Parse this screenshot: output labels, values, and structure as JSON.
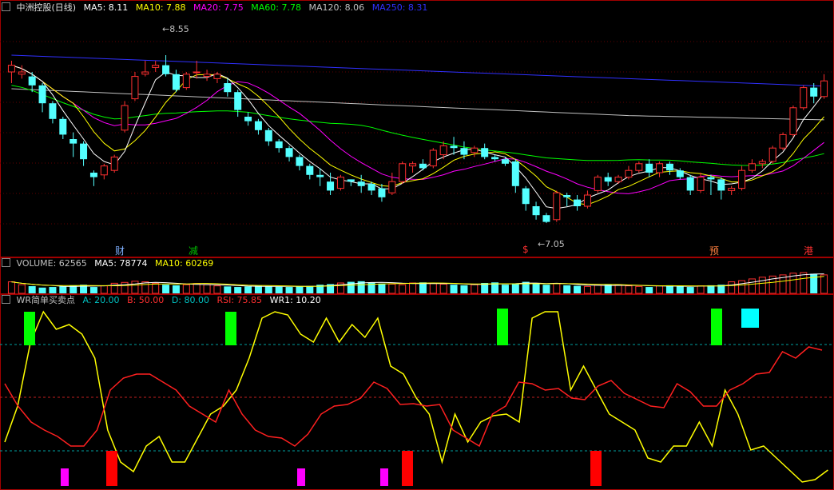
{
  "main": {
    "title": "中洲控股(日线)",
    "ma": [
      {
        "label": "MA5: 8.11",
        "color": "#ffffff"
      },
      {
        "label": "MA10: 7.88",
        "color": "#ffff00"
      },
      {
        "label": "MA20: 7.75",
        "color": "#ff00ff"
      },
      {
        "label": "MA60: 7.78",
        "color": "#00ff00"
      },
      {
        "label": "MA120: 8.06",
        "color": "#c0c0c0"
      },
      {
        "label": "MA250: 8.31",
        "color": "#3030ff"
      }
    ],
    "high_label": "8.55",
    "low_label": "7.05",
    "events": [
      {
        "text": "财",
        "color": "#7fb0ff",
        "pos": 0.14
      },
      {
        "text": "减",
        "color": "#00c000",
        "pos": 0.23
      },
      {
        "text": "$",
        "color": "#ff3030",
        "pos": 0.63
      },
      {
        "text": "预",
        "color": "#ff8040",
        "pos": 0.855
      },
      {
        "text": "港",
        "color": "#ff3030",
        "pos": 0.97
      }
    ]
  },
  "volume": {
    "labels": [
      {
        "label": "VOLUME: 62565",
        "color": "#c0c0c0"
      },
      {
        "label": "MA5: 78774",
        "color": "#ffffff"
      },
      {
        "label": "MA10: 60269",
        "color": "#ffff00"
      }
    ]
  },
  "wr": {
    "labels": [
      {
        "label": "WR简单买卖点",
        "color": "#c0c0c0"
      },
      {
        "label": "A: 20.00",
        "color": "#00c0c0"
      },
      {
        "label": "B: 50.00",
        "color": "#ff3030"
      },
      {
        "label": "D: 80.00",
        "color": "#00c0c0"
      },
      {
        "label": "RSI: 75.85",
        "color": "#ff3030"
      },
      {
        "label": "WR1: 10.20",
        "color": "#ffffff"
      }
    ]
  },
  "chart_data": {
    "type": "candlestick",
    "price_range": [
      6.9,
      8.9
    ],
    "candles": [
      [
        8.4,
        8.46,
        8.3,
        8.5
      ],
      [
        8.38,
        8.4,
        8.34,
        8.46
      ],
      [
        8.36,
        8.28,
        8.22,
        8.4
      ],
      [
        8.28,
        8.12,
        8.04,
        8.3
      ],
      [
        8.12,
        7.98,
        7.94,
        8.14
      ],
      [
        7.98,
        7.84,
        7.8,
        8.0
      ],
      [
        7.8,
        7.76,
        7.64,
        7.86
      ],
      [
        7.76,
        7.62,
        7.56,
        7.78
      ],
      [
        7.5,
        7.46,
        7.38,
        7.52
      ],
      [
        7.48,
        7.56,
        7.44,
        7.58
      ],
      [
        7.52,
        7.64,
        7.5,
        7.66
      ],
      [
        7.88,
        8.1,
        7.86,
        8.14
      ],
      [
        8.16,
        8.36,
        8.14,
        8.4
      ],
      [
        8.38,
        8.4,
        8.36,
        8.5
      ],
      [
        8.44,
        8.46,
        8.4,
        8.5
      ],
      [
        8.46,
        8.38,
        8.36,
        8.55
      ],
      [
        8.38,
        8.24,
        8.22,
        8.42
      ],
      [
        8.26,
        8.38,
        8.24,
        8.4
      ],
      [
        8.4,
        8.4,
        8.34,
        8.5
      ],
      [
        8.36,
        8.38,
        8.32,
        8.42
      ],
      [
        8.34,
        8.38,
        8.3,
        8.4
      ],
      [
        8.3,
        8.22,
        8.18,
        8.34
      ],
      [
        8.22,
        8.06,
        8.0,
        8.24
      ],
      [
        8.0,
        7.96,
        7.92,
        8.04
      ],
      [
        7.96,
        7.88,
        7.84,
        7.98
      ],
      [
        7.88,
        7.78,
        7.74,
        7.9
      ],
      [
        7.78,
        7.72,
        7.68,
        7.8
      ],
      [
        7.72,
        7.64,
        7.6,
        7.74
      ],
      [
        7.64,
        7.56,
        7.52,
        7.66
      ],
      [
        7.56,
        7.48,
        7.44,
        7.58
      ],
      [
        7.48,
        7.46,
        7.38,
        7.54
      ],
      [
        7.42,
        7.34,
        7.3,
        7.5
      ],
      [
        7.36,
        7.46,
        7.34,
        7.48
      ],
      [
        7.44,
        7.42,
        7.38,
        7.44
      ],
      [
        7.42,
        7.38,
        7.32,
        7.48
      ],
      [
        7.4,
        7.34,
        7.3,
        7.42
      ],
      [
        7.36,
        7.28,
        7.24,
        7.4
      ],
      [
        7.32,
        7.42,
        7.3,
        7.5
      ],
      [
        7.42,
        7.58,
        7.4,
        7.6
      ],
      [
        7.56,
        7.58,
        7.5,
        7.6
      ],
      [
        7.58,
        7.54,
        7.52,
        7.62
      ],
      [
        7.56,
        7.7,
        7.54,
        7.72
      ],
      [
        7.66,
        7.74,
        7.62,
        7.78
      ],
      [
        7.74,
        7.72,
        7.66,
        7.82
      ],
      [
        7.72,
        7.66,
        7.62,
        7.78
      ],
      [
        7.68,
        7.72,
        7.64,
        7.74
      ],
      [
        7.72,
        7.64,
        7.62,
        7.76
      ],
      [
        7.64,
        7.62,
        7.6,
        7.66
      ],
      [
        7.62,
        7.58,
        7.56,
        7.64
      ],
      [
        7.6,
        7.38,
        7.32,
        7.62
      ],
      [
        7.36,
        7.22,
        7.16,
        7.38
      ],
      [
        7.2,
        7.12,
        7.08,
        7.24
      ],
      [
        7.12,
        7.06,
        7.05,
        7.14
      ],
      [
        7.08,
        7.32,
        7.06,
        7.34
      ],
      [
        7.3,
        7.28,
        7.2,
        7.32
      ],
      [
        7.26,
        7.2,
        7.16,
        7.3
      ],
      [
        7.2,
        7.3,
        7.18,
        7.34
      ],
      [
        7.34,
        7.46,
        7.32,
        7.48
      ],
      [
        7.46,
        7.42,
        7.38,
        7.5
      ],
      [
        7.42,
        7.46,
        7.4,
        7.48
      ],
      [
        7.46,
        7.52,
        7.44,
        7.56
      ],
      [
        7.52,
        7.58,
        7.5,
        7.6
      ],
      [
        7.58,
        7.5,
        7.46,
        7.62
      ],
      [
        7.5,
        7.58,
        7.46,
        7.6
      ],
      [
        7.58,
        7.52,
        7.48,
        7.6
      ],
      [
        7.52,
        7.46,
        7.44,
        7.54
      ],
      [
        7.46,
        7.34,
        7.3,
        7.48
      ],
      [
        7.34,
        7.46,
        7.32,
        7.5
      ],
      [
        7.46,
        7.44,
        7.3,
        7.48
      ],
      [
        7.44,
        7.34,
        7.26,
        7.46
      ],
      [
        7.34,
        7.36,
        7.3,
        7.38
      ],
      [
        7.36,
        7.52,
        7.34,
        7.56
      ],
      [
        7.52,
        7.58,
        7.5,
        7.62
      ],
      [
        7.58,
        7.6,
        7.54,
        7.62
      ],
      [
        7.6,
        7.72,
        7.58,
        7.74
      ],
      [
        7.72,
        7.84,
        7.7,
        7.86
      ],
      [
        7.84,
        8.08,
        7.82,
        8.1
      ],
      [
        8.08,
        8.26,
        8.06,
        8.28
      ],
      [
        8.26,
        8.18,
        8.12,
        8.3
      ],
      [
        8.18,
        8.32,
        8.16,
        8.38
      ]
    ],
    "volume": [
      40,
      30,
      25,
      20,
      22,
      24,
      28,
      30,
      22,
      26,
      35,
      38,
      42,
      40,
      35,
      30,
      28,
      30,
      34,
      30,
      26,
      24,
      22,
      24,
      26,
      25,
      23,
      22,
      24,
      26,
      30,
      32,
      36,
      40,
      42,
      38,
      34,
      32,
      30,
      36,
      38,
      34,
      32,
      30,
      28,
      30,
      36,
      38,
      30,
      34,
      40,
      36,
      30,
      34,
      28,
      26,
      24,
      28,
      30,
      30,
      26,
      24,
      22,
      26,
      28,
      24,
      22,
      26,
      28,
      30,
      40,
      44,
      50,
      56,
      60,
      64,
      70,
      72,
      68,
      64
    ]
  }
}
